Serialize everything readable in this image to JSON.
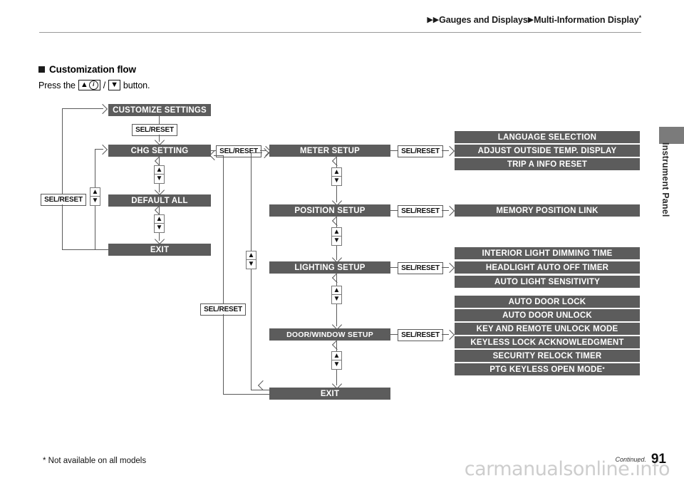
{
  "header": {
    "breadcrumb_1": "Gauges and Displays",
    "breadcrumb_2": "Multi-Information Display",
    "breadcrumb_2_sup": "*",
    "triangle_icon": "▶"
  },
  "sidebar": {
    "chapter_label": "Instrument Panel"
  },
  "section": {
    "heading": "Customization flow",
    "instruction_prefix": "Press the",
    "instruction_separator": "/",
    "instruction_suffix": "button.",
    "key_up_glyph": "▲",
    "key_info_glyph": "i",
    "key_down_glyph": "▼"
  },
  "diagram": {
    "sel_reset_label": "SEL/RESET",
    "arrow_up_glyph": "▲",
    "arrow_down_glyph": "▼",
    "column_left": [
      {
        "label": "CUSTOMIZE SETTINGS"
      },
      {
        "label": "CHG SETTING"
      },
      {
        "label": "DEFAULT ALL"
      },
      {
        "label": "EXIT"
      }
    ],
    "column_middle": [
      {
        "label": "METER SETUP"
      },
      {
        "label": "POSITION SETUP"
      },
      {
        "label": "LIGHTING SETUP"
      },
      {
        "label": "DOOR/WINDOW SETUP"
      },
      {
        "label": "EXIT"
      }
    ],
    "column_right": {
      "meter_setup": [
        {
          "label": "LANGUAGE SELECTION"
        },
        {
          "label": "ADJUST OUTSIDE TEMP. DISPLAY"
        },
        {
          "label": "TRIP A INFO RESET"
        }
      ],
      "position_setup": [
        {
          "label": "MEMORY POSITION LINK"
        }
      ],
      "lighting_setup": [
        {
          "label": "INTERIOR LIGHT DIMMING TIME"
        },
        {
          "label": "HEADLIGHT AUTO OFF TIMER"
        },
        {
          "label": "AUTO LIGHT SENSITIVITY"
        }
      ],
      "door_window_setup": [
        {
          "label": "AUTO DOOR LOCK"
        },
        {
          "label": "AUTO DOOR UNLOCK"
        },
        {
          "label": "KEY AND REMOTE UNLOCK MODE"
        },
        {
          "label": "KEYLESS LOCK ACKNOWLEDGMENT"
        },
        {
          "label": "SECURITY RELOCK TIMER"
        },
        {
          "label": "PTG KEYLESS OPEN MODE",
          "sup": "*"
        }
      ]
    },
    "sel_reset_labels": [
      "SEL/RESET",
      "SEL/RESET",
      "SEL/RESET",
      "SEL/RESET",
      "SEL/RESET",
      "SEL/RESET",
      "SEL/RESET",
      "SEL/RESET",
      "SEL/RESET"
    ]
  },
  "footer": {
    "note": "* Not available on all models",
    "continued": "Continued.",
    "page_number": "91",
    "watermark": "carmanualsonline.info"
  },
  "colors": {
    "bar_fill": "#5c5c5c",
    "line": "#5a5a5a",
    "tab_fill": "#7b7b7b",
    "rule": "#9a9a9a"
  }
}
